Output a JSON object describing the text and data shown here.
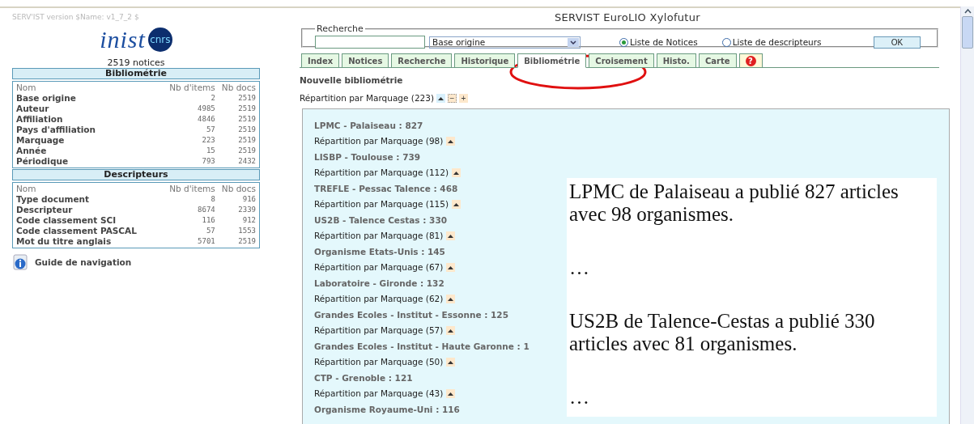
{
  "version_note": "SERV'IST version $Name: v1_7_2 $",
  "logo": {
    "text": "inist",
    "badge": "cnrs"
  },
  "notice_count": "2519 notices",
  "sections": [
    {
      "title": "Bibliométrie",
      "columns": [
        "Nom",
        "Nb d'items",
        "Nb docs"
      ],
      "rows": [
        {
          "name": "Base origine",
          "items": "2",
          "docs": "2519"
        },
        {
          "name": "Auteur",
          "items": "4985",
          "docs": "2519"
        },
        {
          "name": "Affiliation",
          "items": "4846",
          "docs": "2519"
        },
        {
          "name": "Pays d'affiliation",
          "items": "57",
          "docs": "2519"
        },
        {
          "name": "Marquage",
          "items": "223",
          "docs": "2519"
        },
        {
          "name": "Année",
          "items": "15",
          "docs": "2519"
        },
        {
          "name": "Périodique",
          "items": "793",
          "docs": "2432"
        }
      ]
    },
    {
      "title": "Descripteurs",
      "columns": [
        "Nom",
        "Nb d'items",
        "Nb docs"
      ],
      "rows": [
        {
          "name": "Type document",
          "items": "8",
          "docs": "916"
        },
        {
          "name": "Descripteur",
          "items": "8674",
          "docs": "2339"
        },
        {
          "name": "Code classement SCI",
          "items": "116",
          "docs": "912"
        },
        {
          "name": "Code classement PASCAL",
          "items": "57",
          "docs": "1553"
        },
        {
          "name": "Mot du titre anglais",
          "items": "5701",
          "docs": "2519"
        }
      ]
    }
  ],
  "guide_link": "Guide de navigation",
  "window": {
    "title": "SERVIST EuroLIO Xylofutur"
  },
  "search": {
    "legend": "Recherche",
    "select": "Base origine",
    "radios": [
      {
        "label": "Liste de Notices",
        "selected": true
      },
      {
        "label": "Liste de descripteurs",
        "selected": false
      }
    ],
    "button": "OK"
  },
  "tabs": [
    {
      "label": "Index",
      "selected": false
    },
    {
      "label": "Notices",
      "selected": false
    },
    {
      "label": "Recherche",
      "selected": false
    },
    {
      "label": "Historique",
      "selected": false
    },
    {
      "label": "Bibliométrie",
      "selected": true
    },
    {
      "label": "Croisement",
      "selected": false
    },
    {
      "label": "Histo.",
      "selected": false
    },
    {
      "label": "Carte",
      "selected": false
    },
    {
      "label": "?",
      "kind": "help",
      "selected": false
    }
  ],
  "heading": "Nouvelle bibliométrie",
  "distribution": {
    "label": "Répartition par Marquage (223)",
    "minus": "−",
    "plus": "+"
  },
  "entries": [
    {
      "kind": "org",
      "text": "LPMC - Palaiseau : 827"
    },
    {
      "kind": "rep",
      "text": "Répartition par Marquage (98)"
    },
    {
      "kind": "org",
      "text": "LISBP - Toulouse : 739"
    },
    {
      "kind": "rep",
      "text": "Répartition par Marquage (112)"
    },
    {
      "kind": "org",
      "text": "TREFLE - Pessac Talence : 468"
    },
    {
      "kind": "rep",
      "text": "Répartition par Marquage (115)"
    },
    {
      "kind": "org",
      "text": "US2B - Talence Cestas : 330"
    },
    {
      "kind": "rep",
      "text": "Répartition par Marquage (81)"
    },
    {
      "kind": "org",
      "text": "Organisme Etats-Unis : 145"
    },
    {
      "kind": "rep",
      "text": "Répartition par Marquage (67)"
    },
    {
      "kind": "org",
      "text": "Laboratoire - Gironde : 132"
    },
    {
      "kind": "rep",
      "text": "Répartition par Marquage (62)"
    },
    {
      "kind": "org",
      "text": "Grandes Ecoles - Institut - Essonne : 125"
    },
    {
      "kind": "rep",
      "text": "Répartition par Marquage (57)"
    },
    {
      "kind": "org",
      "text": "Grandes Ecoles - Institut - Haute Garonne : 1"
    },
    {
      "kind": "rep",
      "text": "Répartition par Marquage (50)"
    },
    {
      "kind": "org",
      "text": "CTP - Grenoble : 121"
    },
    {
      "kind": "rep",
      "text": "Répartition par Marquage (43)"
    },
    {
      "kind": "org",
      "text": "Organisme Royaume-Uni : 116"
    }
  ],
  "annotation": [
    "LPMC de Palaiseau a publié 827 articles avec 98 organismes.",
    "…",
    "US2B de Talence-Cestas a publié 330 articles avec 81 organismes.",
    "…"
  ]
}
